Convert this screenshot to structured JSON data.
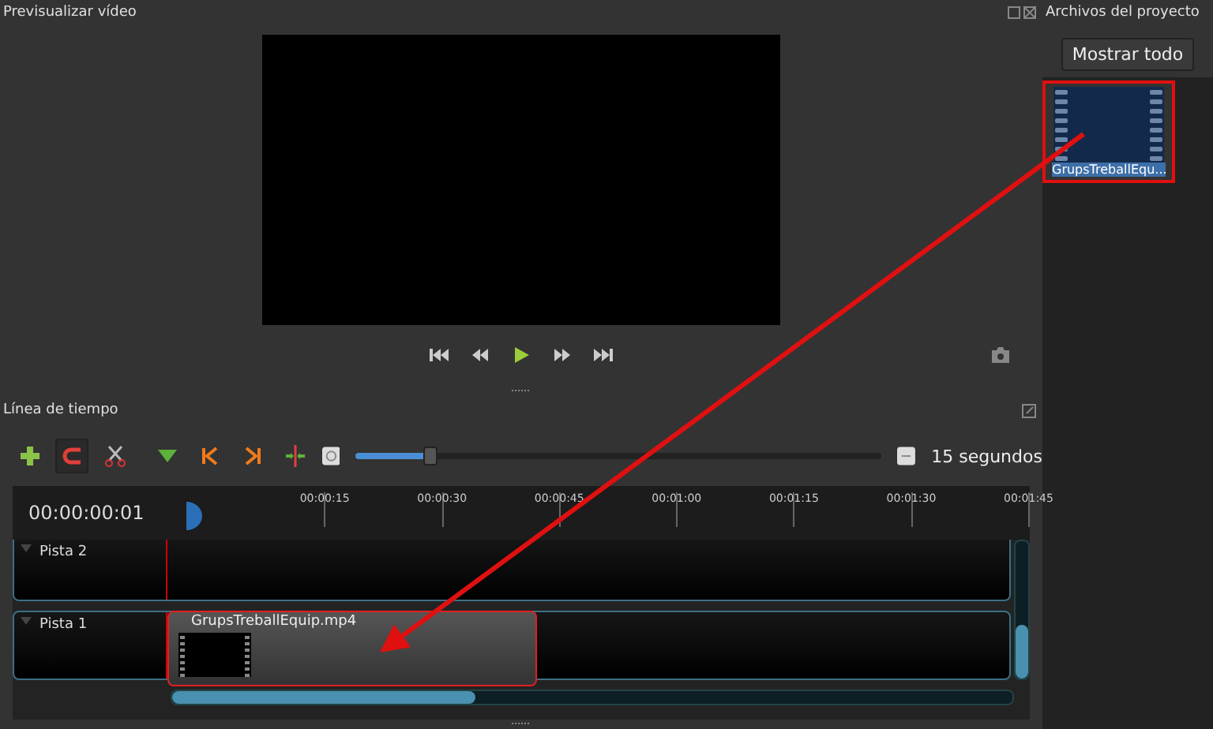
{
  "preview": {
    "title": "Previsualizar vídeo",
    "controls": [
      {
        "kind": "start"
      },
      {
        "kind": "rewind"
      },
      {
        "kind": "play"
      },
      {
        "kind": "forward"
      },
      {
        "kind": "end"
      }
    ]
  },
  "timeline": {
    "title": "Línea de tiempo",
    "tools": [
      {
        "kind": "add",
        "on": false
      },
      {
        "kind": "snap",
        "on": true
      },
      {
        "kind": "razor",
        "on": false
      },
      {
        "kind": "marker",
        "on": false
      },
      {
        "kind": "prev",
        "on": false
      },
      {
        "kind": "next",
        "on": false
      },
      {
        "kind": "center",
        "on": false
      }
    ],
    "zoom": {
      "level": 0.14,
      "label": "15 segundos"
    },
    "timecode": "00:00:00:01",
    "ruler": [
      "00:00:15",
      "00:00:30",
      "00:00:45",
      "00:01:00",
      "00:01:15",
      "00:01:30",
      "00:01:45"
    ],
    "tracks": [
      {
        "name": "Pista 2"
      },
      {
        "name": "Pista 1",
        "clips": [
          {
            "name": "GrupsTreballEquip.mp4",
            "selected": true
          }
        ]
      }
    ]
  },
  "project_files": {
    "title": "Archivos del proyecto",
    "show_all": "Mostrar todo",
    "files": [
      {
        "name": "GrupsTreballEqu...",
        "selected": true
      }
    ]
  }
}
